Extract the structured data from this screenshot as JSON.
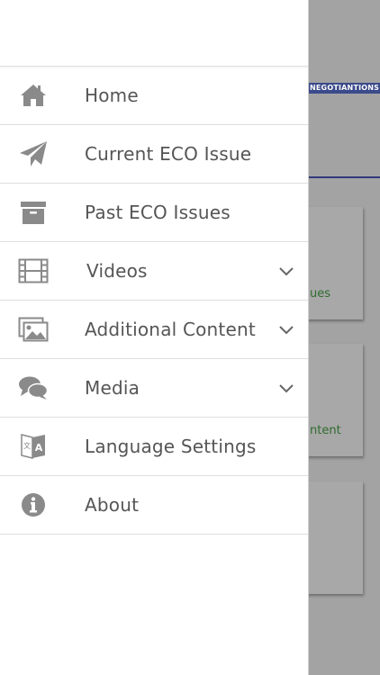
{
  "background": {
    "banner_text": "NEGOTIANTIONS",
    "cards": [
      {
        "text": "ues"
      },
      {
        "text": "ntent"
      },
      {
        "text": ""
      }
    ]
  },
  "drawer": {
    "items": [
      {
        "label": "Home",
        "icon": "home-icon",
        "expandable": false
      },
      {
        "label": "Current ECO Issue",
        "icon": "paper-plane-icon",
        "expandable": false
      },
      {
        "label": "Past ECO Issues",
        "icon": "archive-box-icon",
        "expandable": false
      },
      {
        "label": "Videos",
        "icon": "film-icon",
        "expandable": true
      },
      {
        "label": "Additional Content",
        "icon": "images-icon",
        "expandable": true
      },
      {
        "label": "Media",
        "icon": "chat-bubbles-icon",
        "expandable": true
      },
      {
        "label": "Language Settings",
        "icon": "language-icon",
        "expandable": false
      },
      {
        "label": "About",
        "icon": "info-circle-icon",
        "expandable": false
      }
    ]
  },
  "colors": {
    "icon": "#8a8a8a",
    "label": "#555555",
    "overlay": "#a3a3a3",
    "banner": "#3a4a8a",
    "card_text": "#2f6b2f"
  }
}
